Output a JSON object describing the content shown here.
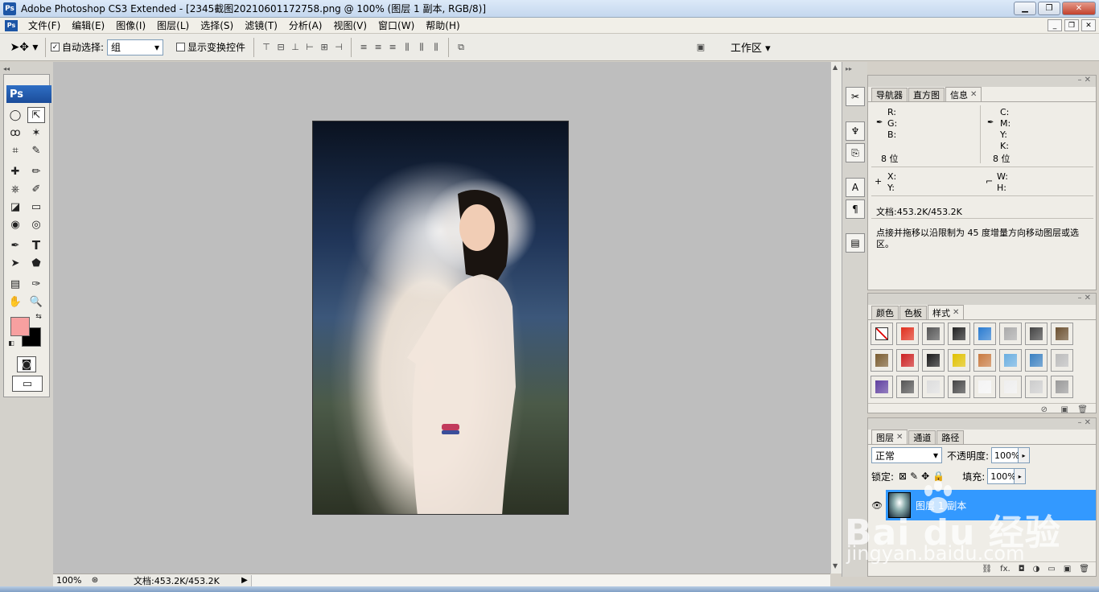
{
  "window": {
    "title": "Adobe Photoshop CS3 Extended - [2345截图20210601172758.png @ 100% (图层 1 副本, RGB/8)]",
    "logo": "Ps",
    "minimize": "▁",
    "maximize": "❐",
    "close": "✕"
  },
  "menubar": {
    "logo": "Ps",
    "items": [
      "文件(F)",
      "编辑(E)",
      "图像(I)",
      "图层(L)",
      "选择(S)",
      "滤镜(T)",
      "分析(A)",
      "视图(V)",
      "窗口(W)",
      "帮助(H)"
    ],
    "doc_min": "_",
    "doc_restore": "❐",
    "doc_close": "✕"
  },
  "options": {
    "auto_select_label": "自动选择:",
    "auto_select_value": "组",
    "show_transform_label": "显示变换控件",
    "workspace_label": "工作区 ▾",
    "auto_select_checked": "✓"
  },
  "toolbox": {
    "badge": "Ps",
    "tools": [
      "◯",
      "⇱",
      "ꝏ",
      "✶",
      "⌗",
      "✎",
      "✚",
      "✏",
      "⎈",
      "✐",
      "◪",
      "▭",
      "◉",
      "◎",
      "✒",
      "T",
      "➤",
      "⬟",
      "▤",
      "✑",
      "✋",
      "🔍"
    ]
  },
  "status": {
    "zoom": "100%",
    "doc": "文档:453.2K/453.2K",
    "arrow": "▶"
  },
  "info_panel": {
    "tabs": [
      "导航器",
      "直方图",
      "信息"
    ],
    "rgb_labels": [
      "R:",
      "G:",
      "B:"
    ],
    "cmyk_labels": [
      "C:",
      "M:",
      "Y:",
      "K:"
    ],
    "bits_left": "8 位",
    "bits_right": "8 位",
    "xy_labels": [
      "X:",
      "Y:"
    ],
    "wh_labels": [
      "W:",
      "H:"
    ],
    "doc": "文档:453.2K/453.2K",
    "hint": "点接并拖移以沿限制为 45 度增量方向移动图层或选区。"
  },
  "styles_panel": {
    "tabs": [
      "颜色",
      "色板",
      "样式"
    ],
    "swatch_colors": [
      "#ffffff",
      "#e0301e",
      "#555555",
      "#222222",
      "#2a7bd0",
      "#aaaaaa",
      "#444444",
      "#6b5030",
      "#7a5c30",
      "#cc2222",
      "#1a1a1a",
      "#e0c000",
      "#c87a40",
      "#6aaee0",
      "#3a80c0",
      "#bbbbbb",
      "#6040a0",
      "#555555",
      "#dddddd",
      "#444444",
      "#f4f4f4",
      "#eeeeee",
      "#cccccc",
      "#999999"
    ]
  },
  "layers_panel": {
    "tabs": [
      "图层",
      "通道",
      "路径"
    ],
    "blend_mode": "正常",
    "opacity_label": "不透明度:",
    "opacity_value": "100%",
    "lock_label": "锁定:",
    "fill_label": "填充:",
    "fill_value": "100%",
    "layer_name": "图层 1 副本",
    "footer_icons": [
      "⛓",
      "fx.",
      "◘",
      "◑",
      "▭",
      "▣",
      "🗑"
    ]
  },
  "watermark": {
    "brand": "Bai du 经验",
    "url": "jingyan.baidu.com"
  }
}
